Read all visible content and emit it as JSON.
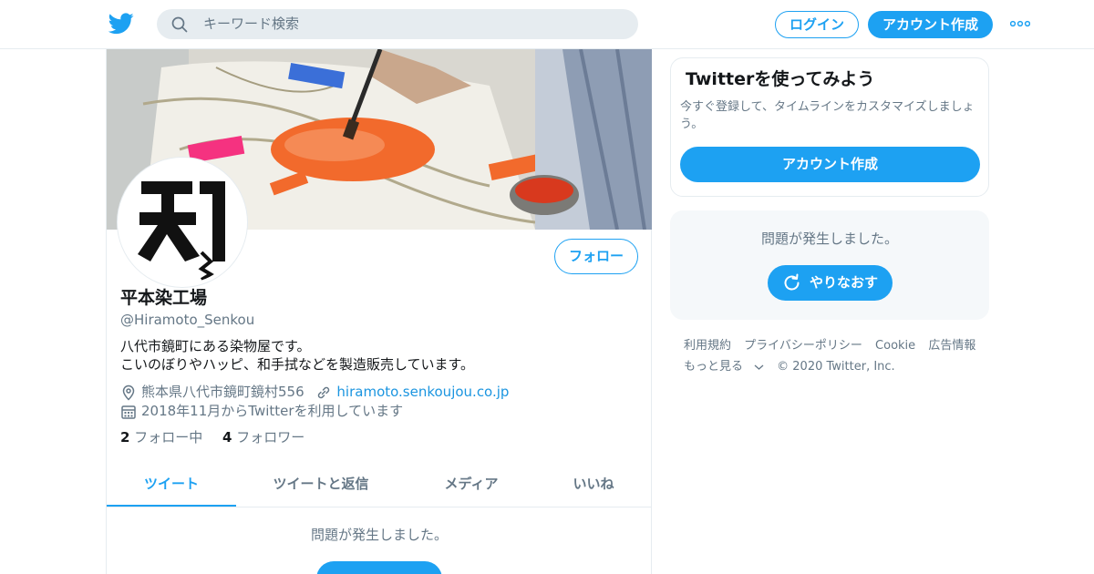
{
  "header": {
    "search_placeholder": "キーワード検索",
    "login_label": "ログイン",
    "signup_label": "アカウント作成"
  },
  "profile": {
    "follow_label": "フォロー",
    "name": "平本染工場",
    "handle": "@Hiramoto_Senkou",
    "bio_line1": "八代市鏡町にある染物屋です。",
    "bio_line2": "こいのぼりやハッピ、和手拭などを製造販売しています。",
    "location": "熊本県八代市鏡町鏡村556",
    "website": "hiramoto.senkoujou.co.jp",
    "joined": "2018年11月からTwitterを利用しています",
    "following_count": "2",
    "following_label": "フォロー中",
    "followers_count": "4",
    "followers_label": "フォロワー"
  },
  "tabs": [
    {
      "label": "ツイート",
      "active": true
    },
    {
      "label": "ツイートと返信",
      "active": false
    },
    {
      "label": "メディア",
      "active": false
    },
    {
      "label": "いいね",
      "active": false
    }
  ],
  "timeline": {
    "error_message": "問題が発生しました。"
  },
  "sidebar": {
    "signup_card": {
      "title": "Twitterを使ってみよう",
      "description": "今すぐ登録して、タイムラインをカスタマイズしましょう。",
      "button_label": "アカウント作成"
    },
    "error_card": {
      "message": "問題が発生しました。",
      "retry_label": "やりなおす"
    },
    "footer": {
      "links": [
        "利用規約",
        "プライバシーポリシー",
        "Cookie",
        "広告情報"
      ],
      "more_label": "もっと見る",
      "copyright": "© 2020 Twitter, Inc."
    }
  },
  "colors": {
    "accent": "#1da1f2",
    "text_secondary": "#657786",
    "border": "#e6ecf0",
    "panel_bg": "#f5f8fa"
  },
  "icons": [
    "twitter-bird-icon",
    "search-icon",
    "more-dots-icon",
    "location-icon",
    "link-icon",
    "calendar-icon",
    "refresh-icon",
    "chevron-down-icon"
  ]
}
